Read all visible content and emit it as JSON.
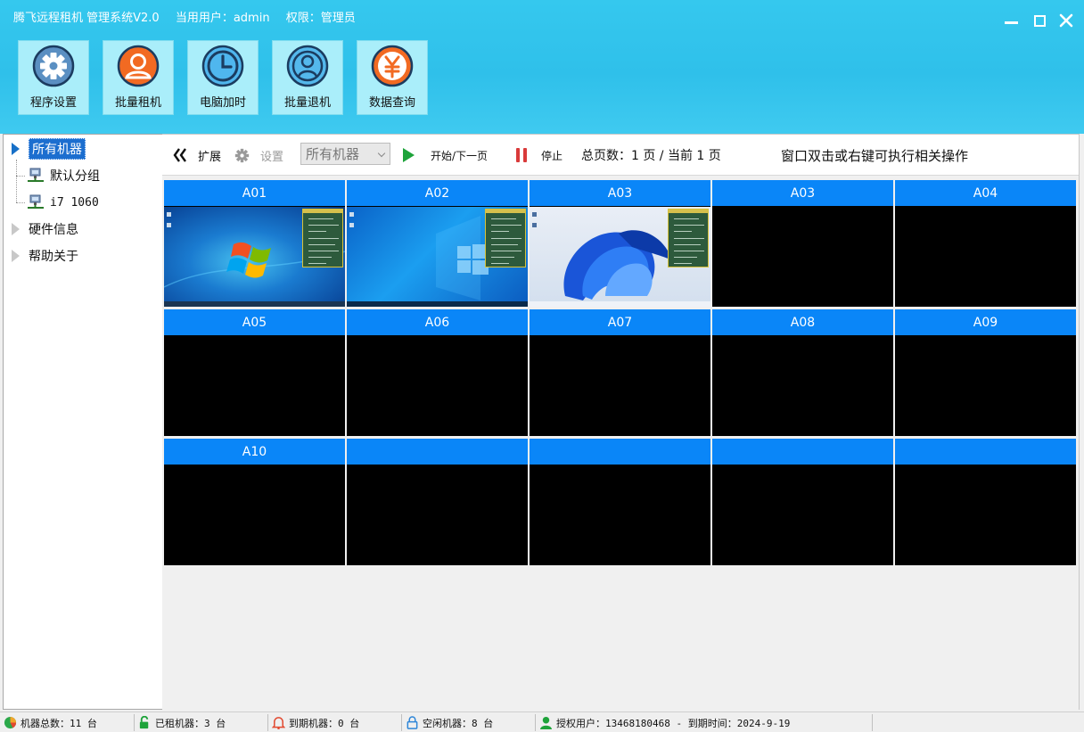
{
  "window": {
    "app_title": "腾飞远程租机 管理系统V2.0",
    "user_label": "当用用户：admin",
    "role_label": "权限：管理员",
    "controls": {
      "minimize": "minimize",
      "maximize": "maximize",
      "close": "✕"
    }
  },
  "toolbar_main": [
    {
      "label": "程序设置",
      "icon": "gear-icon"
    },
    {
      "label": "批量租机",
      "icon": "user-icon"
    },
    {
      "label": "电脑加时",
      "icon": "clock-icon"
    },
    {
      "label": "批量退机",
      "icon": "user-outline-icon"
    },
    {
      "label": "数据查询",
      "icon": "yuan-icon"
    }
  ],
  "tree": {
    "root": "所有机器",
    "children": [
      "默认分组",
      "i7 1060"
    ],
    "others": [
      "硬件信息",
      "帮助关于"
    ]
  },
  "content_toolbar": {
    "expand": "扩展",
    "settings": "设置",
    "filter_value": "所有机器",
    "start": "开始/下一页",
    "stop": "停止",
    "page_info": "总页数：1 页 / 当前 1 页",
    "hint": "窗口双击或右键可执行相关操作"
  },
  "machines": [
    {
      "name": "A01",
      "screen": "win7"
    },
    {
      "name": "A02",
      "screen": "win10"
    },
    {
      "name": "A03",
      "screen": "win11"
    },
    {
      "name": "A03",
      "screen": "off"
    },
    {
      "name": "A04",
      "screen": "off"
    },
    {
      "name": "A05",
      "screen": "off"
    },
    {
      "name": "A06",
      "screen": "off"
    },
    {
      "name": "A07",
      "screen": "off"
    },
    {
      "name": "A08",
      "screen": "off"
    },
    {
      "name": "A09",
      "screen": "off"
    },
    {
      "name": "A10",
      "screen": "off"
    },
    {
      "name": "",
      "screen": "off"
    },
    {
      "name": "",
      "screen": "off"
    },
    {
      "name": "",
      "screen": "off"
    },
    {
      "name": "",
      "screen": "off"
    }
  ],
  "status": {
    "total": "机器总数：11 台",
    "rented": "已租机器：3 台",
    "expired": "到期机器：0 台",
    "idle": "空闲机器：8 台",
    "license": "授权用户：13468180468 - 到期时间：2024-9-19"
  },
  "colors": {
    "header_bg": "#35c8ee",
    "tool_bg": "#aaeefa",
    "cell_header": "#0a86f8",
    "tree_selected": "#1c6ecf"
  }
}
